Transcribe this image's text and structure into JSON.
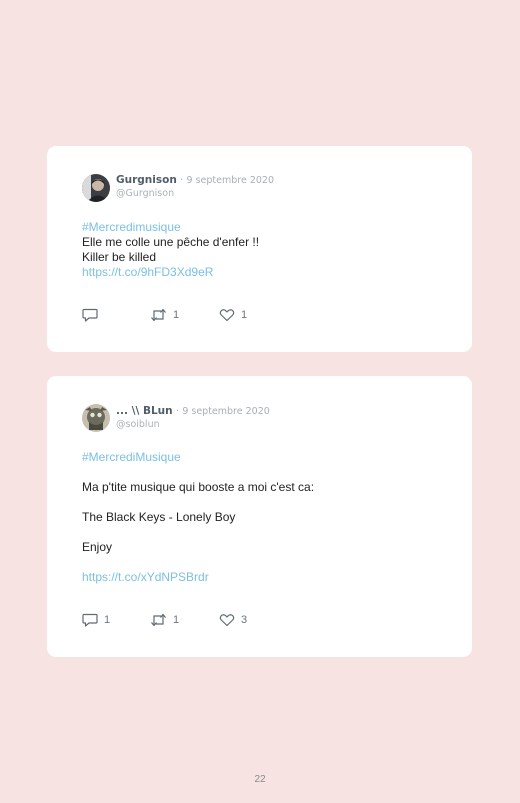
{
  "tweets": [
    {
      "name": "Gurgnison",
      "separator": "·",
      "date": "9 septembre 2020",
      "handle": "@Gurgnison",
      "lines": [
        "#Mercredimusique",
        "Elle me colle une pêche d'enfer !!",
        "Killer be killed",
        "https://t.co/9hFD3Xd9eR"
      ],
      "reply_count": "",
      "retweet_count": "1",
      "like_count": "1"
    },
    {
      "name": "... \\\\ BLun",
      "separator": "·",
      "date": "9 septembre 2020",
      "handle": "@soiblun",
      "lines": [
        "#MercrediMusique",
        "Ma p'tite musique qui booste a moi c'est ca:",
        "The Black Keys - Lonely Boy",
        "Enjoy",
        "https://t.co/xYdNPSBrdr"
      ],
      "reply_count": "1",
      "retweet_count": "1",
      "like_count": "3"
    }
  ],
  "page_number": "22",
  "colors": {
    "background": "#f6e3e2",
    "card": "#ffffff",
    "link": "#7cc0e3"
  }
}
